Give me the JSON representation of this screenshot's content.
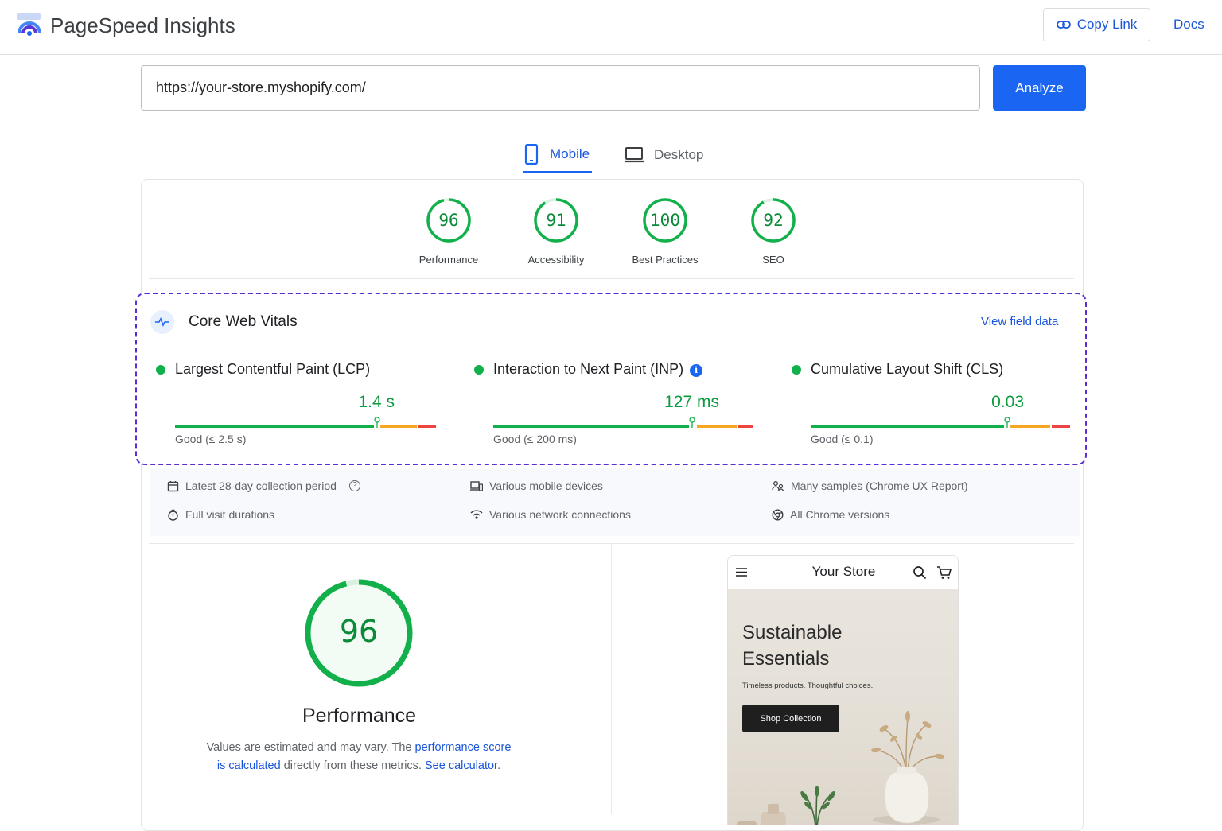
{
  "app": {
    "title": "PageSpeed Insights"
  },
  "header": {
    "copy_link": "Copy Link",
    "docs": "Docs"
  },
  "search": {
    "url": "https://your-store.myshopify.com/",
    "analyze": "Analyze"
  },
  "tabs": [
    {
      "label": "Mobile",
      "active": true
    },
    {
      "label": "Desktop",
      "active": false
    }
  ],
  "scores": [
    {
      "value": "96",
      "label": "Performance",
      "fraction": 0.96
    },
    {
      "value": "91",
      "label": "Accessibility",
      "fraction": 0.91
    },
    {
      "value": "100",
      "label": "Best Practices",
      "fraction": 1.0
    },
    {
      "value": "92",
      "label": "SEO",
      "fraction": 0.92
    }
  ],
  "cwv": {
    "title": "Core Web Vitals",
    "view_field_data": "View field data",
    "metrics": [
      {
        "name": "Largest Contentful Paint (LCP)",
        "value": "1.4 s",
        "threshold": "Good (≤ 2.5 s)"
      },
      {
        "name": "Interaction to Next Paint (INP)",
        "value": "127 ms",
        "threshold": "Good (≤ 200 ms)",
        "info": "i"
      },
      {
        "name": "Cumulative Layout Shift (CLS)",
        "value": "0.03",
        "threshold": "Good (≤ 0.1)"
      }
    ]
  },
  "field_info": {
    "period": "Latest 28-day collection period",
    "help": "?",
    "durations": "Full visit durations",
    "devices": "Various mobile devices",
    "connections": "Various network connections",
    "samples_prefix": "Many samples (",
    "samples_link": "Chrome UX Report",
    "samples_suffix": ")",
    "chrome": "All Chrome versions"
  },
  "performance": {
    "score": "96",
    "fraction": 0.96,
    "title": "Performance",
    "desc_1": "Values are estimated and may vary. The ",
    "desc_link_1": "performance score is calculated",
    "desc_2": " directly from these metrics. ",
    "desc_link_2": "See calculator",
    "desc_3": "."
  },
  "preview": {
    "store_name": "Your Store",
    "hero_title": "Sustainable Essentials",
    "hero_subtitle": "Timeless products. Thoughtful choices.",
    "cta": "Shop Collection"
  },
  "colors": {
    "good": "#12b04a",
    "accent": "#1a66f2",
    "needs_improvement": "#f5a623",
    "poor": "#ef4444",
    "highlight": "#5b2fd6"
  }
}
